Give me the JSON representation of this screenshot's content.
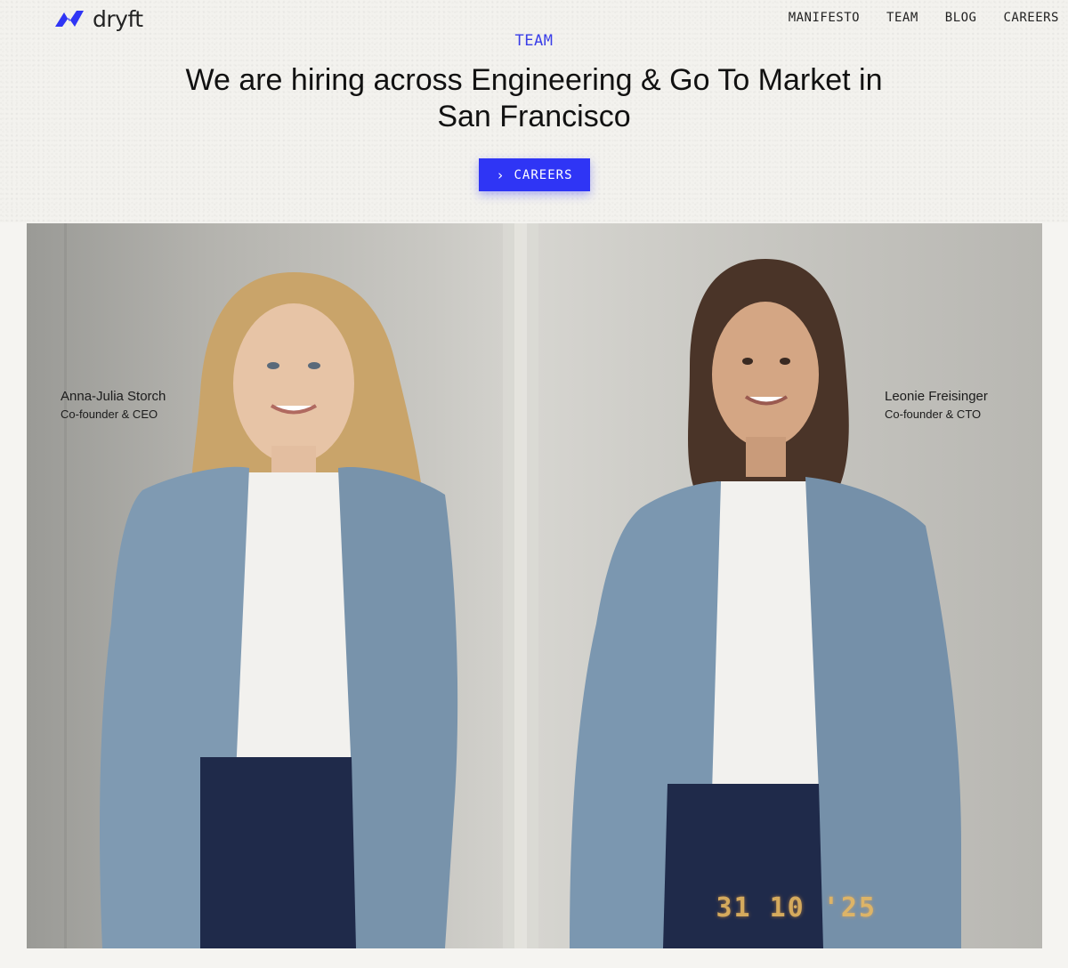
{
  "brand": {
    "name": "dryft",
    "color": "#2f35f5"
  },
  "nav": {
    "items": [
      {
        "label": "MANIFESTO"
      },
      {
        "label": "TEAM"
      },
      {
        "label": "BLOG"
      },
      {
        "label": "CAREERS"
      }
    ]
  },
  "hero": {
    "eyebrow": "TEAM",
    "headline": "We are hiring across Engineering & Go To Market in San Francisco",
    "cta_label": "CAREERS",
    "cta_icon": "chevron-right-icon"
  },
  "photo": {
    "people": [
      {
        "name": "Anna-Julia Storch",
        "role": "Co-founder & CEO"
      },
      {
        "name": "Leonie Freisinger",
        "role": "Co-founder & CTO"
      }
    ],
    "date_stamp": "31 10 '25"
  }
}
